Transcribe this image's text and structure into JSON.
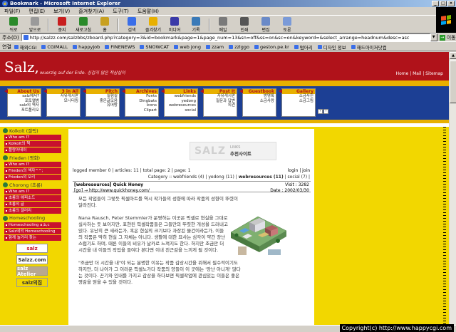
{
  "window": {
    "title": "Bookmark - Microsoft Internet Explorer"
  },
  "menu": [
    "파일(F)",
    "편집(E)",
    "보기(V)",
    "즐겨찾기(A)",
    "도구(T)",
    "도움말(H)"
  ],
  "toolbar": [
    {
      "label": "뒤로",
      "icon": "back-icon",
      "color": "#2a8a2a"
    },
    {
      "label": "앞으로",
      "icon": "forward-icon",
      "color": "#9a9a9a"
    },
    {
      "label": "중지",
      "icon": "stop-icon",
      "color": "#c81e1e"
    },
    {
      "label": "새로고침",
      "icon": "refresh-icon",
      "color": "#2a8a2a"
    },
    {
      "label": "홈",
      "icon": "home-icon",
      "color": "#c8a020"
    },
    {
      "label": "검색",
      "icon": "search-icon",
      "color": "#3a6ee8"
    },
    {
      "label": "즐겨찾기",
      "icon": "favorites-icon",
      "color": "#e8b000"
    },
    {
      "label": "미디어",
      "icon": "media-icon",
      "color": "#3a3aa8"
    },
    {
      "label": "기록",
      "icon": "history-icon",
      "color": "#3a7ab8"
    },
    {
      "label": "메일",
      "icon": "mail-icon",
      "color": "#7a7a7a"
    },
    {
      "label": "인쇄",
      "icon": "print-icon",
      "color": "#555555"
    },
    {
      "label": "편집",
      "icon": "edit-icon",
      "color": "#6a8ac8"
    },
    {
      "label": "토론",
      "icon": "discuss-icon",
      "color": "#7a9ad8"
    }
  ],
  "address": {
    "label": "주소(D)",
    "url": "http://salzz.com/salzbbs/zboard.php?category=3&id=bookmark&page=1&page_num=13&sn=off&ss=on&sc=on&keyword=&select_arrange=headnum&desc=asc",
    "go_label": "이동"
  },
  "links": {
    "label": "연결",
    "items": [
      "해외CGI",
      "CGIMALL",
      "happyjob",
      "FINENEWS",
      "SNOWCAT",
      "web jong",
      "zzam",
      "zzlggo",
      "geston.pe.kr",
      "텀어리",
      "디자인 정보",
      "해드아이저닷컴"
    ]
  },
  "site": {
    "logo": "Salz,",
    "tagline": "wuerzig auf der Erde. 싱겁지 않은 적삼실이",
    "header_links": "Home | Mail | Sitemap"
  },
  "nav": [
    {
      "title": "About Us",
      "items": [
        "salz에서?",
        "포토앨범",
        "salz의 역사",
        "포트폴리오"
      ]
    },
    {
      "title": "3 in All",
      "items": [
        "자유게시판",
        "모니터링",
        "",
        ""
      ]
    },
    {
      "title": "Pitch",
      "items": [
        "실험실",
        "좋은글모음",
        "유머방",
        ""
      ]
    },
    {
      "title": "Archives",
      "items": [
        "Fonts",
        "Dingbats",
        "Icons",
        "Clipart"
      ]
    },
    {
      "title": "Links",
      "items": [
        "webfriends",
        "yedong",
        "webresources",
        "social"
      ]
    },
    {
      "title": "Post It",
      "items": [
        "자유게시판",
        "질문과 답변",
        "의견",
        ""
      ]
    },
    {
      "title": "Guestbook",
      "items": [
        "방명록",
        "소금사랑",
        "",
        ""
      ]
    },
    {
      "title": "Gallery",
      "items": [
        "소금사진",
        "소금그림",
        "",
        ""
      ]
    }
  ],
  "sidebar": [
    {
      "head": "Kolkolt (갤릭)",
      "items": [
        "Who am I?",
        "Kolkolt의 책",
        "플랑어데이"
      ]
    },
    {
      "head": "Frieden (평화)",
      "items": [
        "Who am I?",
        "Frieden의 액자^^;",
        "Frieden의 오리"
      ]
    },
    {
      "head": "Chorong (초롱)",
      "items": [
        "Who am I?",
        "초롱의 애피소드",
        "초롱의 글",
        "초롱의 갤러리"
      ]
    },
    {
      "head": "Homeschooling",
      "items": [
        "Homeschooling a,b,c",
        "Salz네의 Homeschooling",
        "함께 놀거리 찾는"
      ]
    }
  ],
  "side_logos": [
    {
      "label": "salz",
      "bg": "#ffffff",
      "fg": "#c8102e"
    },
    {
      "label": "Salzz.com",
      "bg": "#ffffff",
      "fg": "#333333"
    },
    {
      "label": "salz Atelier",
      "bg": "#b8a890",
      "fg": "#ffffff"
    },
    {
      "label": "salz의집",
      "bg": "#f2d700",
      "fg": "#333333"
    }
  ],
  "board": {
    "banner_big": "SALZ",
    "banner_small": "LINKS",
    "banner_title": "추천사이트",
    "logged": "logged member 0 | articles: 11 | total page: 2 | page: 1",
    "login": "login | join",
    "categories_prefix": "Category :: webfriends (4) | yedong (11) | ",
    "category_active": "webresources (11)",
    "categories_suffix": " | social (7) |",
    "post_title": "[webresources] Quick Honey",
    "post_link": "[go] → http://www.quickhoney.com/",
    "visits": "Visit : 3282",
    "date": "Date : 2002/03/30",
    "paragraphs": [
      "모든 작업들이 그렇듯 픽셀아트를 역시 작가들의 성향에 따라 작품의 성향이 뚜렷이 달라진다.",
      "Nana Rausch, Peter Stemmler가 운영하는 이곳은 픽셀로 현실을 그대로 실사하는 듯 보이지만, 표현된 픽셀작품들은 그들만의 뚜렷한 개성을 드러내고 있다. 유난히 큰 새라든가, 혹은 현실의 크기보다 과장된 물건이라든가, 이들의 작품은 딱히 현실 그 자체는 아니다. 생활에 대한 묘사는 심각이 약간 장난스럽기도 하며, 때론 이들의 비유가 날카로 느껴지도 한다. 하지만 조금만 더 시간을 내 이들의 작업을 들여다 본다면 이내 친근감을 느끼게 될 것이다.",
      "\"조금만 더 시간을 내\"야 되는 분명한 이유는 작품 감상시간을 위해서 필수적이기도 하지만, 더 나아가 그 이러운 픽셀노가다 작품의 양들이 이 곳에는 '장난 아니게' 많다는 것이다. 끈기와 인내를 가지고 감상을 하다보면 픽셀작업에 관심있는 이들은 좋은 영감을 얻을 수 있을 것이다."
    ]
  },
  "copyright": "Copyright(c) http://www.happycgi.com"
}
